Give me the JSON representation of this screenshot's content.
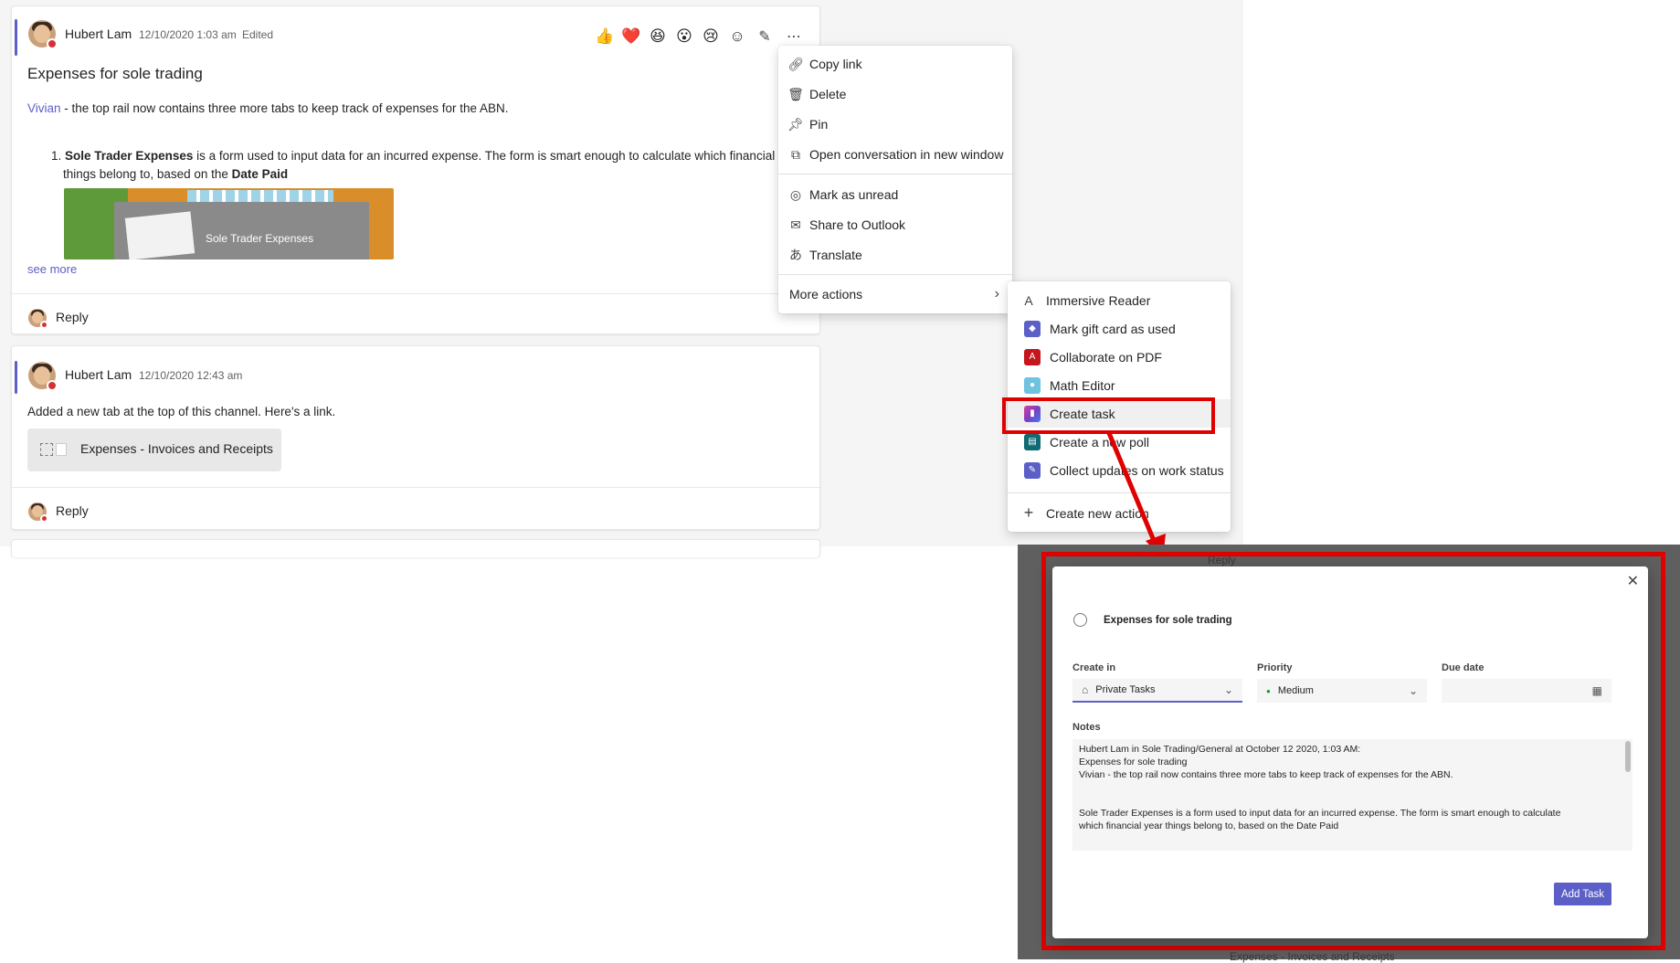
{
  "posts": [
    {
      "author": "Hubert Lam",
      "timestamp": "12/10/2020 1:03 am",
      "edited": "Edited",
      "title": "Expenses for sole trading",
      "mention": "Vivian",
      "line1_rest": " - the top rail now contains three more tabs to keep track of expenses for the ABN.",
      "list_number": "1.",
      "item_bold": "Sole Trader Expenses",
      "item_text": " is a form used to input data for an incurred expense. The form is smart enough to calculate which financial y",
      "item_text2": "things belong to, based on the ",
      "item_bold2": "Date Paid",
      "thumbnail_label": "Sole Trader Expenses",
      "see_more": "see more",
      "reply": "Reply"
    },
    {
      "author": "Hubert Lam",
      "timestamp": "12/10/2020 12:43 am",
      "body": "Added a new tab at the top of this channel. Here's a link.",
      "tab_chip": "Expenses - Invoices and Receipts",
      "reply": "Reply"
    }
  ],
  "reactions": [
    "👍",
    "❤️",
    "😆",
    "😮",
    "😢"
  ],
  "context_menu": {
    "items": [
      {
        "icon": "link-icon",
        "label": "Copy link"
      },
      {
        "icon": "trash-icon",
        "label": "Delete"
      },
      {
        "icon": "pin-icon",
        "label": "Pin"
      },
      {
        "icon": "popout-icon",
        "label": "Open conversation in new window"
      },
      {
        "icon": "unread-icon",
        "label": "Mark as unread"
      },
      {
        "icon": "mail-icon",
        "label": "Share to Outlook"
      },
      {
        "icon": "translate-icon",
        "label": "Translate"
      }
    ],
    "more_actions": "More actions"
  },
  "submenu": {
    "items": [
      {
        "icon": "immersive-reader-icon",
        "label": "Immersive Reader",
        "color": ""
      },
      {
        "icon": "gift-card-icon",
        "label": "Mark gift card as used",
        "color": "#5b5fc7"
      },
      {
        "icon": "pdf-icon",
        "label": "Collaborate on PDF",
        "color": "#c4161c"
      },
      {
        "icon": "math-editor-icon",
        "label": "Math Editor",
        "color": "#6fc3df"
      },
      {
        "icon": "planner-icon",
        "label": "Create task",
        "color": "#7b3fbf"
      },
      {
        "icon": "poll-icon",
        "label": "Create a new poll",
        "color": "#0f6b73"
      },
      {
        "icon": "status-icon",
        "label": "Collect updates on work status",
        "color": "#5b5fc7"
      }
    ],
    "create_new_action": "Create new action"
  },
  "background_text": {
    "reply": "Reply",
    "tab_chip": "Expenses - Invoices and Receipts"
  },
  "task_dialog": {
    "task_title": "Expenses for sole trading",
    "create_in_label": "Create in",
    "create_in_value": "Private Tasks",
    "priority_label": "Priority",
    "priority_value": "Medium",
    "due_date_label": "Due date",
    "due_date_value": "",
    "notes_label": "Notes",
    "notes_lines": [
      "Hubert Lam in Sole Trading/General at October 12 2020, 1:03 AM:",
      "Expenses for sole trading",
      "Vivian - the top rail now contains three more tabs to keep track of expenses for the ABN.",
      "",
      "",
      "Sole Trader Expenses is a form used to input data for an incurred expense. The form is smart enough to calculate",
      "which financial year things belong to, based on the Date Paid"
    ],
    "add_button": "Add Task"
  },
  "colors": {
    "accent": "#5b5fc7",
    "highlight": "#e00000",
    "presence_busy": "#d13438"
  }
}
